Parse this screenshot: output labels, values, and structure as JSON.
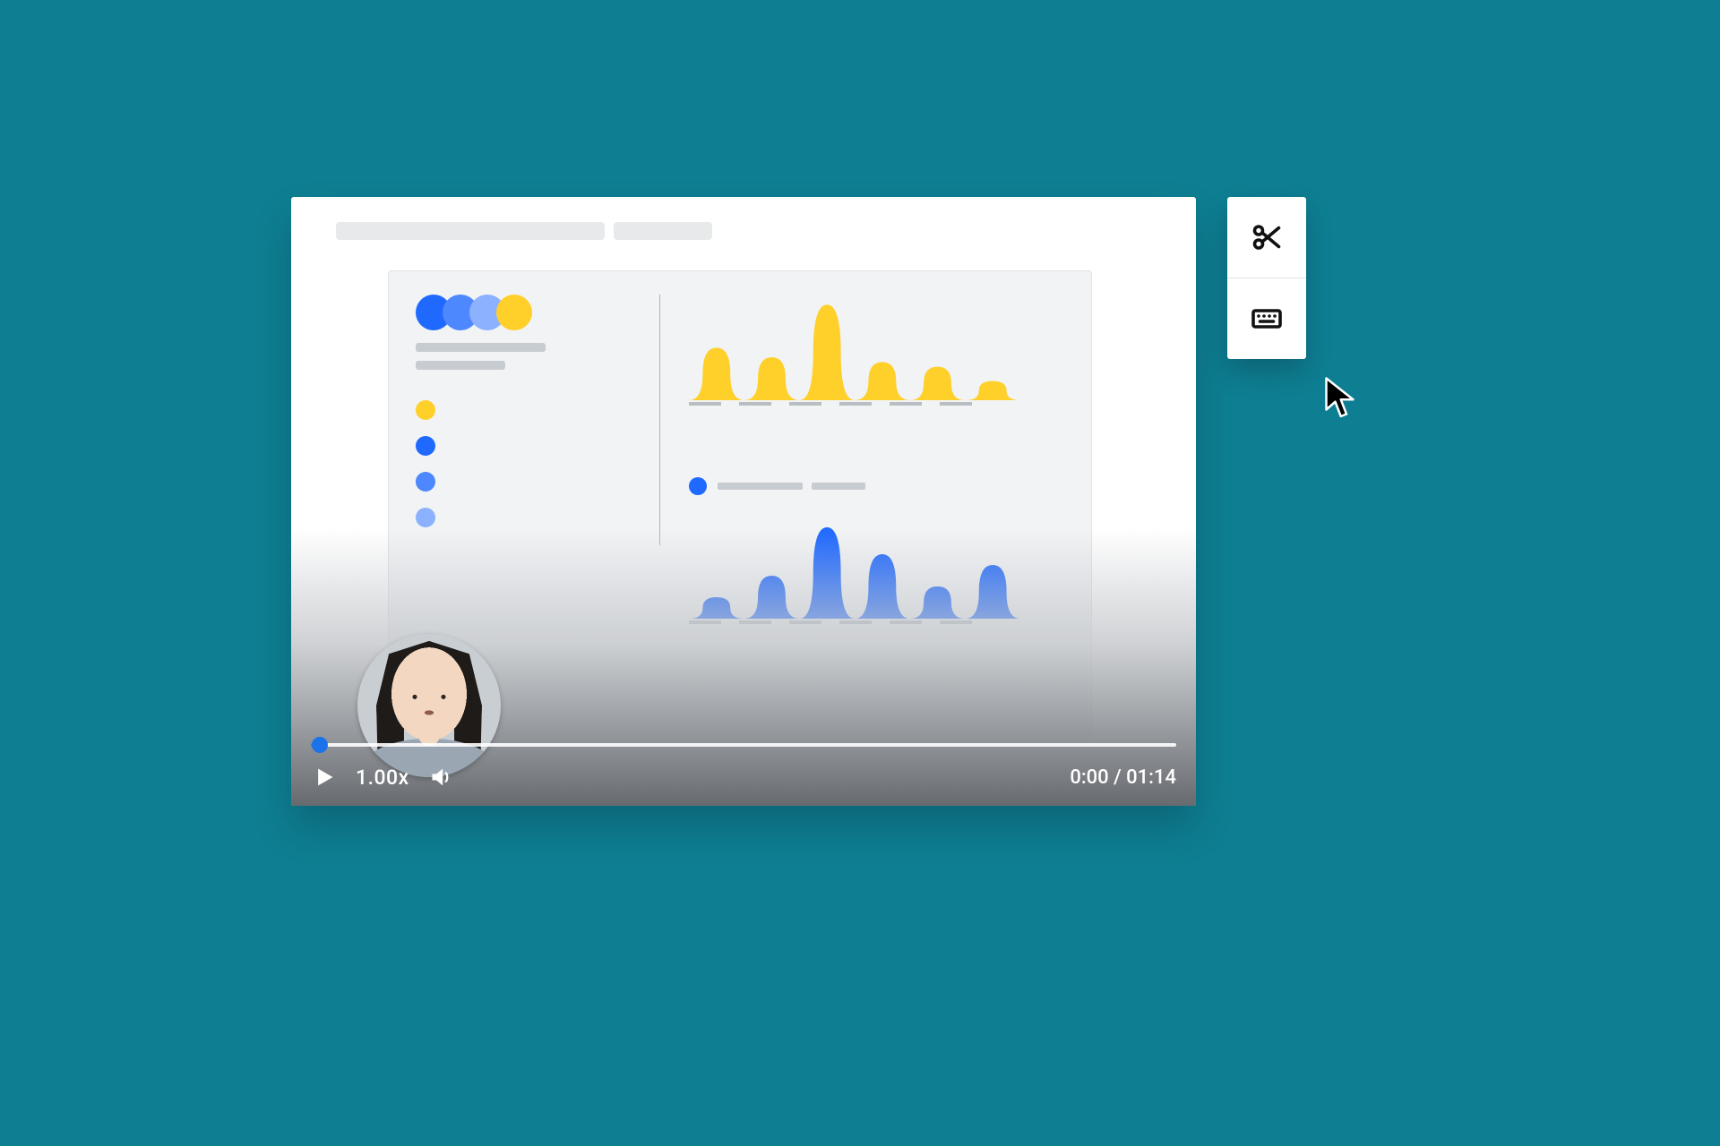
{
  "colors": {
    "page_bg": "#0e7e92",
    "accent_blue": "#1f69ff",
    "accent_mid_blue": "#4d88ff",
    "accent_light_blue": "#8cb1ff",
    "accent_yellow": "#ffd02a",
    "scrub_handle": "#1a73e8"
  },
  "player": {
    "playback_speed": "1.00x",
    "current_time": "0:00",
    "duration": "01:14",
    "time_separator": " / ",
    "progress_ratio": 0.0
  },
  "toolbar": {
    "items": [
      {
        "name": "scissors-icon"
      },
      {
        "name": "keyboard-icon"
      }
    ]
  },
  "presentation": {
    "header_dot_colors": [
      "accent_blue",
      "accent_mid_blue",
      "accent_light_blue",
      "accent_yellow"
    ],
    "legend": [
      {
        "color": "accent_yellow"
      },
      {
        "color": "accent_blue"
      },
      {
        "color": "accent_mid_blue"
      },
      {
        "color": "accent_light_blue"
      }
    ]
  },
  "chart_data": [
    {
      "type": "area",
      "title": "",
      "series": [
        {
          "name": "yellow",
          "color": "#ffd02a",
          "values": [
            0,
            22,
            0,
            18,
            0,
            40,
            0,
            16,
            0,
            14,
            0,
            8,
            0
          ]
        }
      ],
      "x": [
        0,
        1,
        2,
        3,
        4,
        5,
        6,
        7,
        8,
        9,
        10,
        11,
        12
      ],
      "xlabel": "",
      "ylabel": "",
      "ylim": [
        0,
        45
      ],
      "x_ticks": 6
    },
    {
      "type": "area",
      "title": "",
      "series": [
        {
          "name": "blue",
          "color": "#1f69ff",
          "values": [
            0,
            8,
            0,
            16,
            0,
            34,
            0,
            24,
            0,
            12,
            0,
            20,
            0
          ]
        }
      ],
      "x": [
        0,
        1,
        2,
        3,
        4,
        5,
        6,
        7,
        8,
        9,
        10,
        11,
        12
      ],
      "xlabel": "",
      "ylabel": "",
      "ylim": [
        0,
        40
      ],
      "x_ticks": 6
    }
  ]
}
